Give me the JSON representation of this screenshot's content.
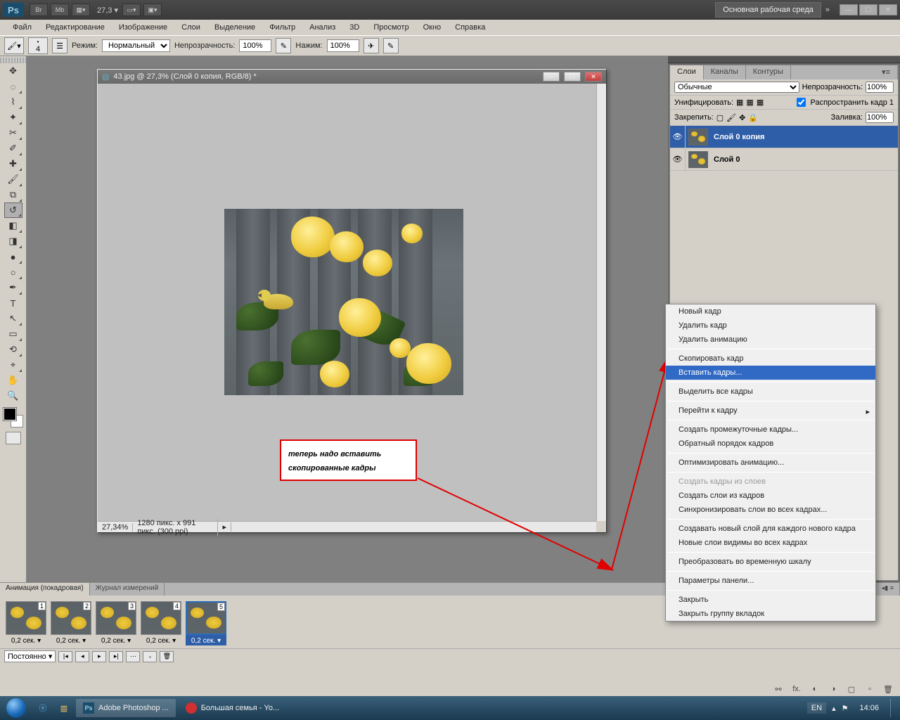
{
  "titlebar": {
    "br_label": "Br",
    "mb_label": "Mb",
    "zoom_display": "27,3",
    "workspace_label": "Основная рабочая среда",
    "expand_glyph": "»"
  },
  "menubar": [
    "Файл",
    "Редактирование",
    "Изображение",
    "Слои",
    "Выделение",
    "Фильтр",
    "Анализ",
    "3D",
    "Просмотр",
    "Окно",
    "Справка"
  ],
  "optbar": {
    "brush_size": "4",
    "mode_label": "Режим:",
    "mode_value": "Нормальный",
    "opacity_label": "Непрозрачность:",
    "opacity_value": "100%",
    "flow_label": "Нажим:",
    "flow_value": "100%"
  },
  "document": {
    "title": "43.jpg @ 27,3% (Слой 0 копия, RGB/8) *",
    "status_zoom": "27,34%",
    "status_dims": "1280 пикс. x 991 пикс. (300 ppi)"
  },
  "annotation": {
    "text": "теперь надо вставить скопированные кадры"
  },
  "layers_panel": {
    "tabs": [
      "Слои",
      "Каналы",
      "Контуры"
    ],
    "blend_mode": "Обычные",
    "opacity_label": "Непрозрачность:",
    "opacity_value": "100%",
    "unify_label": "Унифицировать:",
    "propagate_label": "Распространить кадр 1",
    "lock_label": "Закрепить:",
    "fill_label": "Заливка:",
    "fill_value": "100%",
    "layers": [
      {
        "name": "Слой 0 копия",
        "active": true
      },
      {
        "name": "Слой 0",
        "active": false
      }
    ]
  },
  "context_menu": [
    {
      "label": "Новый кадр",
      "type": "item"
    },
    {
      "label": "Удалить кадр",
      "type": "item"
    },
    {
      "label": "Удалить анимацию",
      "type": "item"
    },
    {
      "type": "sep"
    },
    {
      "label": "Скопировать кадр",
      "type": "item"
    },
    {
      "label": "Вставить кадры...",
      "type": "item",
      "highlighted": true
    },
    {
      "type": "sep"
    },
    {
      "label": "Выделить все кадры",
      "type": "item"
    },
    {
      "type": "sep"
    },
    {
      "label": "Перейти к кадру",
      "type": "item",
      "submenu": true
    },
    {
      "type": "sep"
    },
    {
      "label": "Создать промежуточные кадры...",
      "type": "item"
    },
    {
      "label": "Обратный порядок кадров",
      "type": "item"
    },
    {
      "type": "sep"
    },
    {
      "label": "Оптимизировать анимацию...",
      "type": "item"
    },
    {
      "type": "sep"
    },
    {
      "label": "Создать кадры из слоев",
      "type": "item",
      "disabled": true
    },
    {
      "label": "Создать слои из кадров",
      "type": "item"
    },
    {
      "label": "Синхронизировать слои во всех кадрах...",
      "type": "item"
    },
    {
      "type": "sep"
    },
    {
      "label": "Создавать новый слой для каждого нового кадра",
      "type": "item"
    },
    {
      "label": "Новые слои видимы во всех кадрах",
      "type": "item"
    },
    {
      "type": "sep"
    },
    {
      "label": "Преобразовать во временную шкалу",
      "type": "item"
    },
    {
      "type": "sep"
    },
    {
      "label": "Параметры панели...",
      "type": "item"
    },
    {
      "type": "sep"
    },
    {
      "label": "Закрыть",
      "type": "item"
    },
    {
      "label": "Закрыть группу вкладок",
      "type": "item"
    }
  ],
  "animation_panel": {
    "tabs": [
      "Анимация (покадровая)",
      "Журнал измерений"
    ],
    "frames": [
      {
        "num": "1",
        "time": "0,2 сек.",
        "selected": false
      },
      {
        "num": "2",
        "time": "0,2 сек.",
        "selected": false
      },
      {
        "num": "3",
        "time": "0,2 сек.",
        "selected": false
      },
      {
        "num": "4",
        "time": "0,2 сек.",
        "selected": false
      },
      {
        "num": "5",
        "time": "0,2 сек.",
        "selected": true
      }
    ],
    "loop_mode": "Постоянно"
  },
  "taskbar": {
    "items": [
      {
        "label": "Adobe Photoshop ...",
        "active": true,
        "icon_color": "#1a4d6b"
      },
      {
        "label": "Большая семья - Yo...",
        "active": false,
        "icon_color": "#d03030"
      }
    ],
    "lang": "EN",
    "time": "14:06"
  }
}
